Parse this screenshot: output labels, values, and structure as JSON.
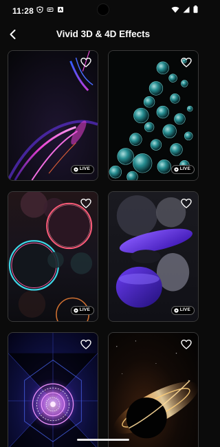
{
  "status_bar": {
    "time": "11:28",
    "left_icons": [
      "shield-icon",
      "vpn-shield-icon",
      "news-icon",
      "app-notification-icon"
    ],
    "right_icons": [
      "wifi-icon",
      "signal-icon",
      "battery-icon"
    ]
  },
  "header": {
    "title": "Vivid 3D & 4D Effects",
    "back_icon": "arrow-back-icon"
  },
  "wallpapers": [
    {
      "name": "neon-streaks",
      "favorite_icon": "heart-outline-icon",
      "live": true,
      "live_label": "LIVE"
    },
    {
      "name": "glass-spheres",
      "favorite_icon": "heart-outline-icon",
      "live": true,
      "live_label": "LIVE"
    },
    {
      "name": "neon-rings",
      "favorite_icon": "heart-outline-icon",
      "live": true,
      "live_label": "LIVE"
    },
    {
      "name": "purple-discs",
      "favorite_icon": "heart-outline-icon",
      "live": true,
      "live_label": "LIVE"
    },
    {
      "name": "mandala-tunnel",
      "favorite_icon": "heart-outline-icon",
      "live": false
    },
    {
      "name": "black-hole",
      "favorite_icon": "heart-outline-icon",
      "live": false
    }
  ],
  "colors": {
    "background": "#0b0b0b",
    "card_border": "#3a3a3a",
    "accent_neon_pink": "#e63fd0",
    "accent_cyan": "#3fd6d6",
    "accent_purple": "#5a2ee0"
  }
}
